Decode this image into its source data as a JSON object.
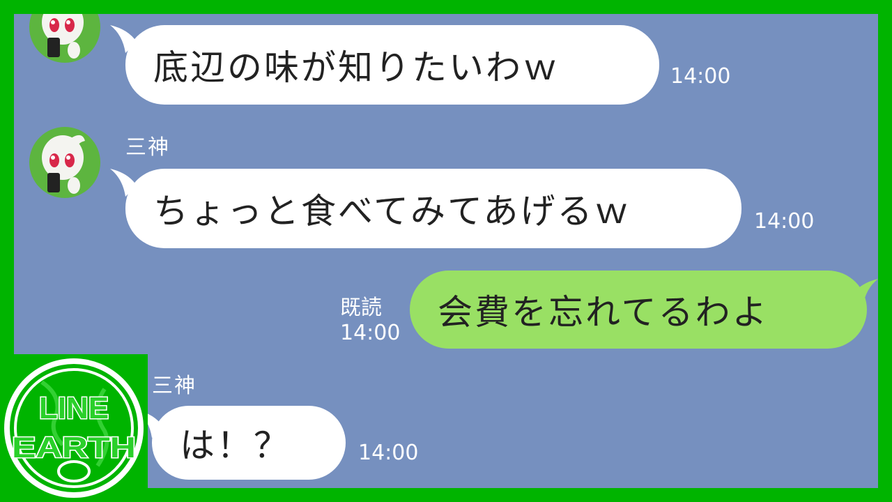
{
  "chat": {
    "messages": [
      {
        "side": "in",
        "text": "底辺の味が知りたいわｗ",
        "time": "14:00"
      },
      {
        "side": "in",
        "sender": "三神",
        "text": "ちょっと食べてみてあげるｗ",
        "time": "14:00"
      },
      {
        "side": "out",
        "text": "会費を忘れてるわよ",
        "read": "既読",
        "time": "14:00"
      },
      {
        "side": "in",
        "sender": "三神",
        "text": "は！？",
        "time": "14:00"
      }
    ]
  },
  "logo": {
    "line1": "LINE",
    "line2": "EARTH"
  },
  "colors": {
    "frame": "#00b400",
    "chat_bg": "#7690bf",
    "bubble_in": "#ffffff",
    "bubble_out": "#99e064",
    "avatar_bg": "#5db53f"
  }
}
